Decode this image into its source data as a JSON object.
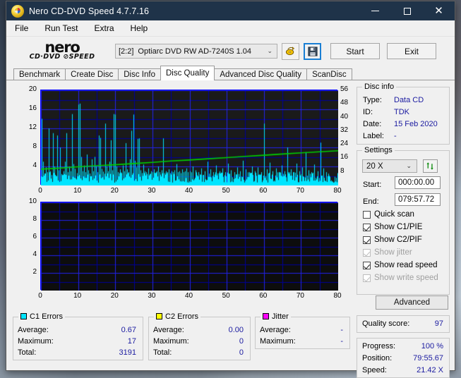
{
  "window": {
    "title": "Nero CD-DVD Speed 4.7.7.16",
    "app_icon": "cd-disc-icon",
    "minimize": "–",
    "maximize": "□",
    "close": "✕"
  },
  "menu": {
    "items": [
      "File",
      "Run Test",
      "Extra",
      "Help"
    ]
  },
  "toolbar": {
    "logo_line1": "nero",
    "logo_line2": "CD·DVD ⊘SPEED",
    "drive_bracket": "[2:2]",
    "drive_name": "Optiarc DVD RW AD-7240S 1.04",
    "dropdown_chevron": "⌄",
    "eject_icon": "disc-eject-icon",
    "save_icon": "floppy-save-icon",
    "start_label": "Start",
    "exit_label": "Exit"
  },
  "tabs": {
    "items": [
      "Benchmark",
      "Create Disc",
      "Disc Info",
      "Disc Quality",
      "Advanced Disc Quality",
      "ScanDisc"
    ],
    "active": "Disc Quality"
  },
  "disc_info": {
    "title": "Disc info",
    "rows": [
      {
        "label": "Type:",
        "value": "Data CD"
      },
      {
        "label": "ID:",
        "value": "TDK"
      },
      {
        "label": "Date:",
        "value": "15 Feb 2020"
      },
      {
        "label": "Label:",
        "value": "-"
      }
    ]
  },
  "settings": {
    "title": "Settings",
    "speed_value": "20 X",
    "speed_chevron": "⌄",
    "refresh_icon": "refresh-arrows-icon",
    "start_label": "Start:",
    "start_value": "000:00.00",
    "end_label": "End:",
    "end_value": "079:57.72",
    "checkboxes": [
      {
        "label": "Quick scan",
        "checked": false,
        "disabled": false
      },
      {
        "label": "Show C1/PIE",
        "checked": true,
        "disabled": false
      },
      {
        "label": "Show C2/PIF",
        "checked": true,
        "disabled": false
      },
      {
        "label": "Show jitter",
        "checked": true,
        "disabled": true
      },
      {
        "label": "Show read speed",
        "checked": true,
        "disabled": false
      },
      {
        "label": "Show write speed",
        "checked": true,
        "disabled": true
      }
    ],
    "advanced_label": "Advanced"
  },
  "quality": {
    "label": "Quality score:",
    "value": "97"
  },
  "progress": {
    "rows": [
      {
        "label": "Progress:",
        "value": "100 %"
      },
      {
        "label": "Position:",
        "value": "79:55.67"
      },
      {
        "label": "Speed:",
        "value": "21.42 X"
      }
    ]
  },
  "stats": {
    "c1": {
      "title": "C1 Errors",
      "color": "#00e5ff",
      "rows": [
        {
          "label": "Average:",
          "value": "0.67"
        },
        {
          "label": "Maximum:",
          "value": "17"
        },
        {
          "label": "Total:",
          "value": "3191"
        }
      ]
    },
    "c2": {
      "title": "C2 Errors",
      "color": "#ffff00",
      "rows": [
        {
          "label": "Average:",
          "value": "0.00"
        },
        {
          "label": "Maximum:",
          "value": "0"
        },
        {
          "label": "Total:",
          "value": "0"
        }
      ]
    },
    "jitter": {
      "title": "Jitter",
      "color": "#ff00ff",
      "rows": [
        {
          "label": "Average:",
          "value": "-"
        },
        {
          "label": "Maximum:",
          "value": "-"
        }
      ]
    }
  },
  "chart_data": [
    {
      "type": "line",
      "name": "c1-error-chart",
      "title": "",
      "xlabel": "",
      "ylabel": "",
      "xlim": [
        0,
        80
      ],
      "ylim": [
        0,
        20
      ],
      "y2lim": [
        0,
        56
      ],
      "xticks": [
        0,
        10,
        20,
        30,
        40,
        50,
        60,
        70,
        80
      ],
      "yticks": [
        4,
        8,
        12,
        16,
        20
      ],
      "y2ticks": [
        8,
        16,
        24,
        32,
        40,
        48,
        56
      ],
      "grid": true,
      "bg": "#1a1a1a",
      "grid_color": "#0000cc",
      "series": [
        {
          "name": "C1 errors",
          "color": "#00e5ff",
          "kind": "spikes",
          "x": [
            0.2,
            0.6,
            1.0,
            1.3,
            1.7,
            2.1,
            2.4,
            2.8,
            3.2,
            3.6,
            4.0,
            4.4,
            4.8,
            5.2,
            5.6,
            6.0,
            6.4,
            6.8,
            7.2,
            7.6,
            8.0,
            8.4,
            8.8,
            9.2,
            9.6,
            10.0,
            10.4,
            10.8,
            11.2,
            11.6,
            12.0,
            12.4,
            12.8,
            13.2,
            13.6,
            14.0,
            14.4,
            14.8,
            15.2,
            15.6,
            16.0,
            16.4,
            16.8,
            17.2,
            17.6,
            18.0,
            18.4,
            18.8,
            19.2,
            19.6,
            20.0,
            20.4,
            20.8,
            21.2,
            21.6,
            22.0,
            22.4,
            22.8,
            23.2,
            23.6,
            24.0,
            24.4,
            24.8,
            25.2,
            25.6,
            26.0,
            26.4,
            26.8,
            27.2,
            27.6,
            28.0,
            28.4,
            28.8,
            29.2,
            29.6,
            30.0,
            30.4,
            30.8,
            31.2,
            31.6,
            32.0,
            32.4,
            32.8,
            33.2,
            33.6,
            34.0,
            34.4,
            34.8,
            35.2,
            35.6,
            36.0,
            36.4,
            36.8,
            37.2,
            37.6,
            38.0,
            38.4,
            38.8,
            39.2,
            39.6,
            40.0,
            40.8,
            41.6,
            42.4,
            43.2,
            44.0,
            44.8,
            45.6,
            46.4,
            47.2,
            48.0,
            48.8,
            49.6,
            50.4,
            51.2,
            52.0,
            52.8,
            53.6,
            54.4,
            55.2,
            56.0,
            56.8,
            57.6,
            58.4,
            59.2,
            60.0,
            60.8,
            61.6,
            62.4,
            63.2,
            64.0,
            64.8,
            65.6,
            66.4,
            67.2,
            68.0,
            68.8,
            69.6,
            70.4,
            71.2,
            72.0,
            72.8,
            73.6,
            74.4,
            75.2,
            76.0,
            76.8,
            77.6,
            78.4,
            79.2
          ],
          "y": [
            14.0,
            5.0,
            2.5,
            3.8,
            2.0,
            12.0,
            3.0,
            2.2,
            11.0,
            4.0,
            2.0,
            10.5,
            3.2,
            8.0,
            2.4,
            3.0,
            5.0,
            11.0,
            2.8,
            4.0,
            3.0,
            15.0,
            4.5,
            3.5,
            2.6,
            17.0,
            17.2,
            6.0,
            3.0,
            4.2,
            2.8,
            6.5,
            3.2,
            2.5,
            5.5,
            3.0,
            6.0,
            4.0,
            2.8,
            10.5,
            10.0,
            3.5,
            2.9,
            13.0,
            4.0,
            3.0,
            5.0,
            9.5,
            3.2,
            15.0,
            14.9,
            4.0,
            2.8,
            3.4,
            2.6,
            4.2,
            3.0,
            8.9,
            3.4,
            2.8,
            5.5,
            11.5,
            14.9,
            5.2,
            3.8,
            9.8,
            9.9,
            3.2,
            2.6,
            4.4,
            3.0,
            2.8,
            3.6,
            2.4,
            3.0,
            2.8,
            3.4,
            2.6,
            3.0,
            4.0,
            2.8,
            3.2,
            9.9,
            2.6,
            3.0,
            2.8,
            3.4,
            2.6,
            3.0,
            2.8,
            3.2,
            4.5,
            2.8,
            3.0,
            2.6,
            3.4,
            2.8,
            3.0,
            3.6,
            2.8,
            3.0,
            4.0,
            3.2,
            2.8,
            3.6,
            3.0,
            5.0,
            3.4,
            2.8,
            4.2,
            3.0,
            3.6,
            2.8,
            4.6,
            3.2,
            2.8,
            3.8,
            3.0,
            5.2,
            3.4,
            2.8,
            4.0,
            3.0,
            3.8,
            2.8,
            13.0,
            3.4,
            4.8,
            3.0,
            3.6,
            2.8,
            4.2,
            3.0,
            8.0,
            3.4,
            2.8,
            4.6,
            3.0,
            3.8,
            7.0,
            3.2,
            2.8,
            4.4,
            3.0,
            9.0,
            3.6,
            2.8
          ]
        },
        {
          "name": "Read speed",
          "color": "#00d000",
          "kind": "line",
          "axis": "y2",
          "x": [
            0,
            5,
            10,
            15,
            20,
            25,
            30,
            35,
            40,
            45,
            50,
            55,
            60,
            65,
            70,
            75,
            80
          ],
          "y": [
            9.6,
            10.2,
            11.0,
            11.6,
            12.2,
            12.9,
            13.6,
            14.4,
            15.0,
            15.7,
            16.4,
            17.1,
            17.8,
            18.5,
            19.2,
            19.8,
            20.4
          ]
        }
      ]
    },
    {
      "type": "line",
      "name": "c2-error-chart",
      "title": "",
      "xlabel": "",
      "ylabel": "",
      "xlim": [
        0,
        80
      ],
      "ylim": [
        0,
        10
      ],
      "xticks": [
        0,
        10,
        20,
        30,
        40,
        50,
        60,
        70,
        80
      ],
      "yticks": [
        2,
        4,
        6,
        8,
        10
      ],
      "grid": true,
      "bg": "#0d0d0d",
      "grid_color": "#0000cc",
      "series": [
        {
          "name": "C2 errors",
          "color": "#ffff00",
          "kind": "spikes",
          "x": [],
          "y": []
        }
      ]
    }
  ]
}
